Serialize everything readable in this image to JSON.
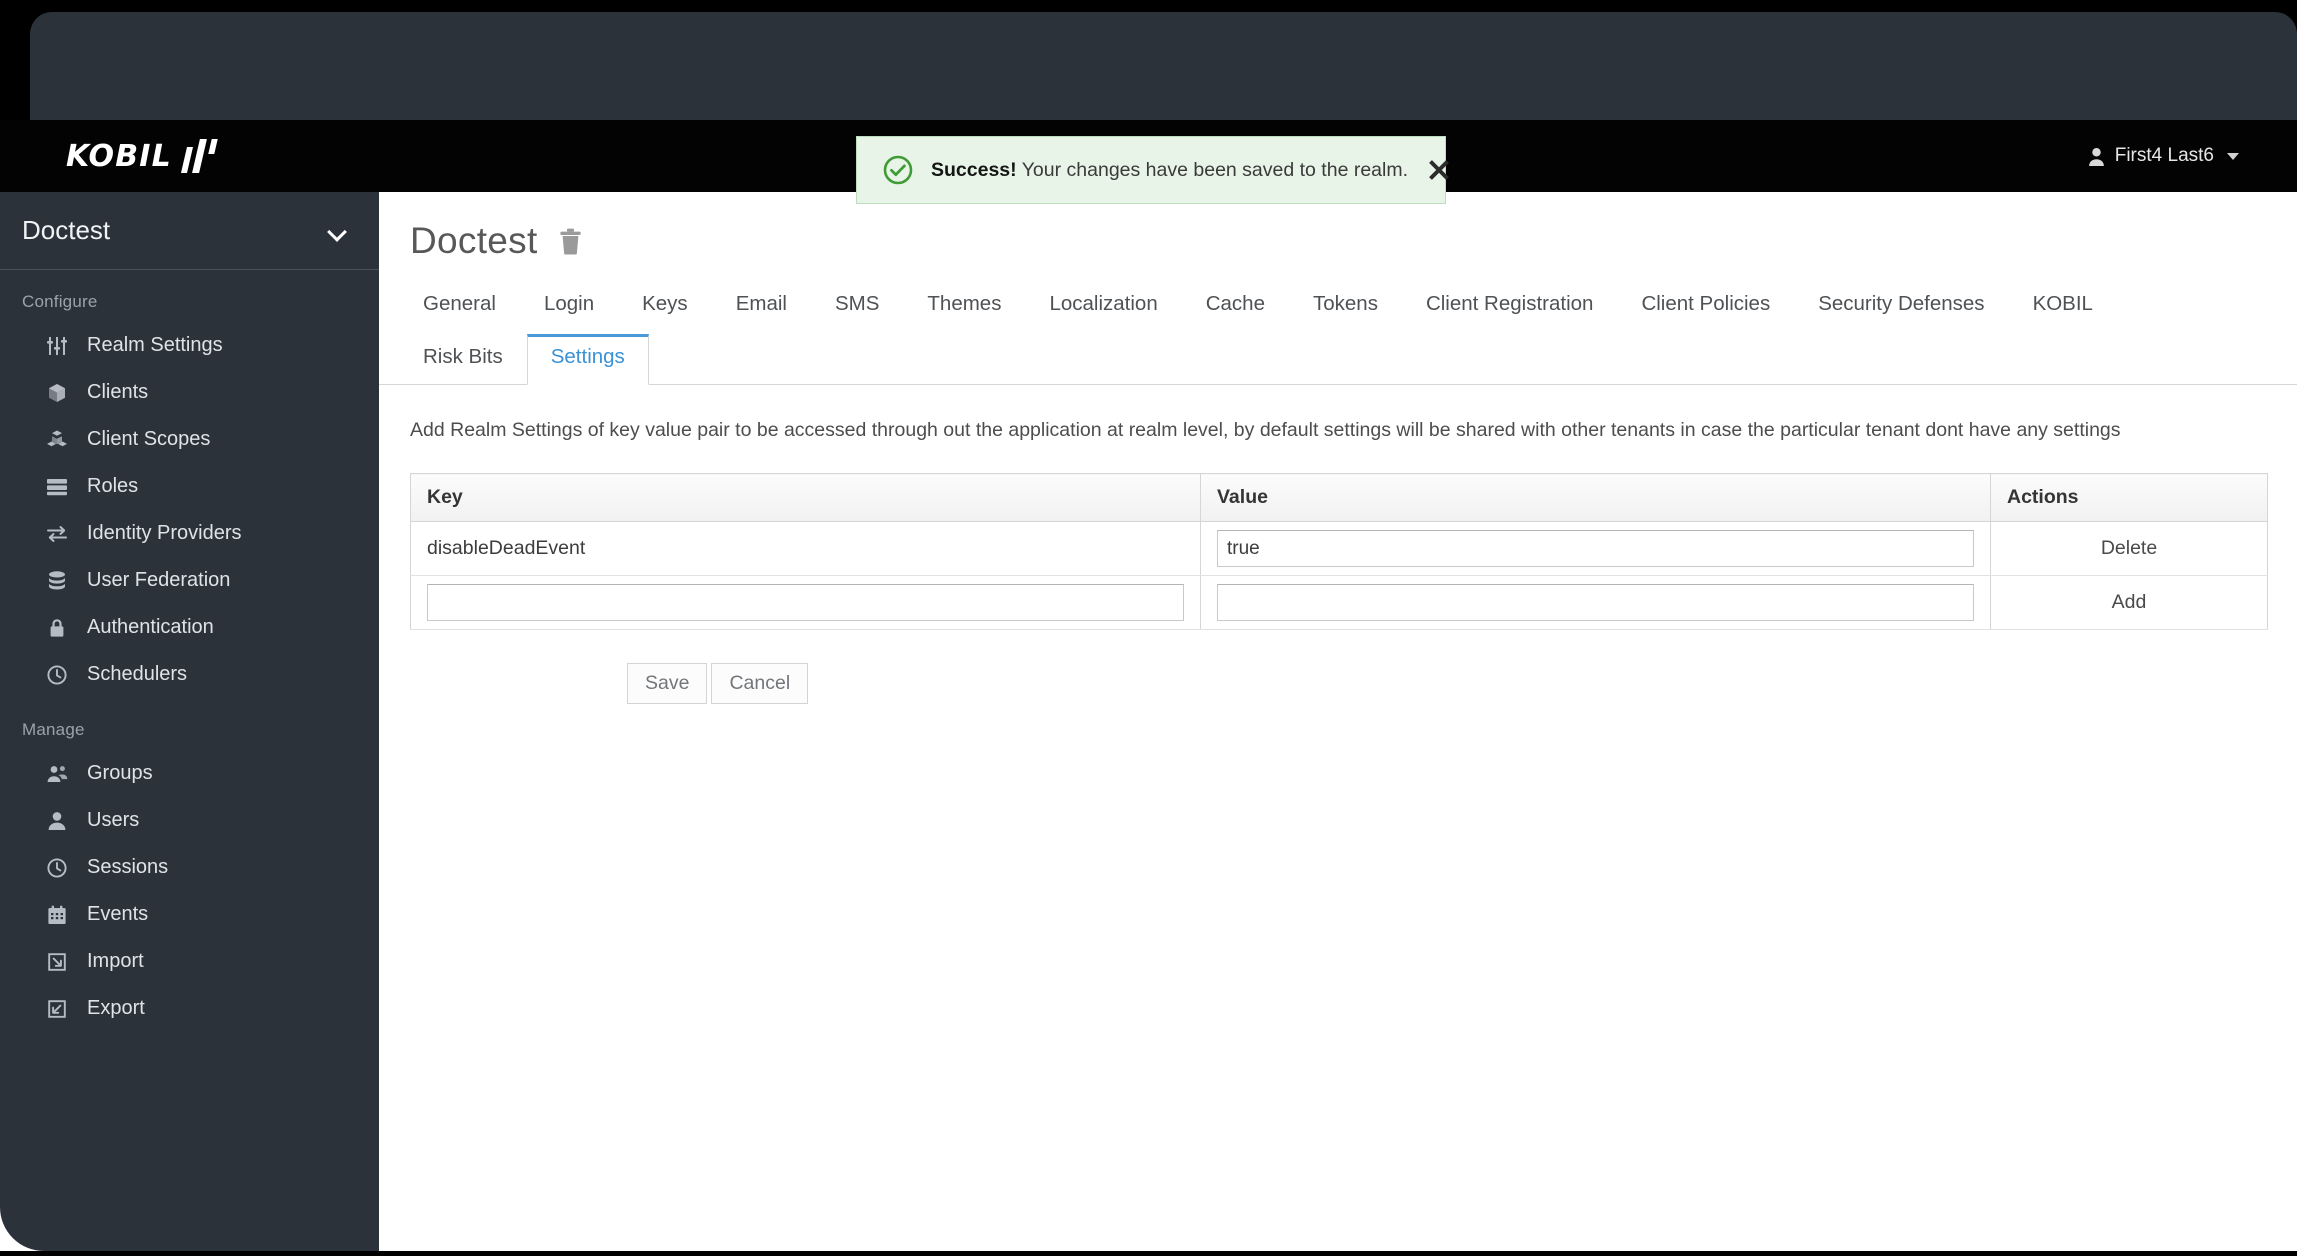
{
  "masthead": {
    "brand_word": "KOBIL",
    "brand_mark": "kobil-bars-logo",
    "user_name": "First4 Last6"
  },
  "alert": {
    "icon": "check-circle-icon",
    "title": "Success!",
    "message": "Your changes have been saved to the realm.",
    "close_label": "close-icon",
    "accent_color": "#3f9c35",
    "background_color": "#e7f4e7"
  },
  "sidebar": {
    "realm_name": "Doctest",
    "groups": [
      {
        "title": "Configure",
        "items": [
          {
            "label": "Realm Settings",
            "icon": "sliders-icon"
          },
          {
            "label": "Clients",
            "icon": "cube-icon"
          },
          {
            "label": "Client Scopes",
            "icon": "cubes-icon"
          },
          {
            "label": "Roles",
            "icon": "list-server-icon"
          },
          {
            "label": "Identity Providers",
            "icon": "exchange-arrows-icon"
          },
          {
            "label": "User Federation",
            "icon": "database-icon"
          },
          {
            "label": "Authentication",
            "icon": "lock-icon"
          },
          {
            "label": "Schedulers",
            "icon": "clock-icon"
          }
        ]
      },
      {
        "title": "Manage",
        "items": [
          {
            "label": "Groups",
            "icon": "users-group-icon"
          },
          {
            "label": "Users",
            "icon": "user-icon"
          },
          {
            "label": "Sessions",
            "icon": "clock-icon"
          },
          {
            "label": "Events",
            "icon": "calendar-icon"
          },
          {
            "label": "Import",
            "icon": "import-arrow-icon"
          },
          {
            "label": "Export",
            "icon": "export-arrow-icon"
          }
        ]
      }
    ]
  },
  "page": {
    "title": "Doctest",
    "delete_icon": "trash-icon",
    "tabs_row1": [
      {
        "label": "General",
        "active": false
      },
      {
        "label": "Login",
        "active": false
      },
      {
        "label": "Keys",
        "active": false
      },
      {
        "label": "Email",
        "active": false
      },
      {
        "label": "SMS",
        "active": false
      },
      {
        "label": "Themes",
        "active": false
      },
      {
        "label": "Localization",
        "active": false
      },
      {
        "label": "Cache",
        "active": false
      },
      {
        "label": "Tokens",
        "active": false
      },
      {
        "label": "Client Registration",
        "active": false
      },
      {
        "label": "Client Policies",
        "active": false
      },
      {
        "label": "Security Defenses",
        "active": false
      },
      {
        "label": "KOBIL",
        "active": false
      }
    ],
    "tabs_row2": [
      {
        "label": "Risk Bits",
        "active": false
      },
      {
        "label": "Settings",
        "active": true
      }
    ],
    "active_tab_color": "#3a92d4",
    "description": "Add Realm Settings of key value pair to be accessed through out the application at realm level, by default settings will be shared with other tenants in case the particular tenant dont have any settings"
  },
  "table": {
    "headers": [
      "Key",
      "Value",
      "Actions"
    ],
    "rows": [
      {
        "key": "disableDeadEvent",
        "key_is_input": false,
        "key_value": "",
        "key_placeholder": "",
        "value": "true",
        "value_placeholder": "",
        "action": "Delete"
      },
      {
        "key": "",
        "key_is_input": true,
        "key_value": "",
        "key_placeholder": "",
        "value": "",
        "value_placeholder": "",
        "action": "Add"
      }
    ]
  },
  "form_actions": {
    "save_label": "Save",
    "cancel_label": "Cancel"
  }
}
